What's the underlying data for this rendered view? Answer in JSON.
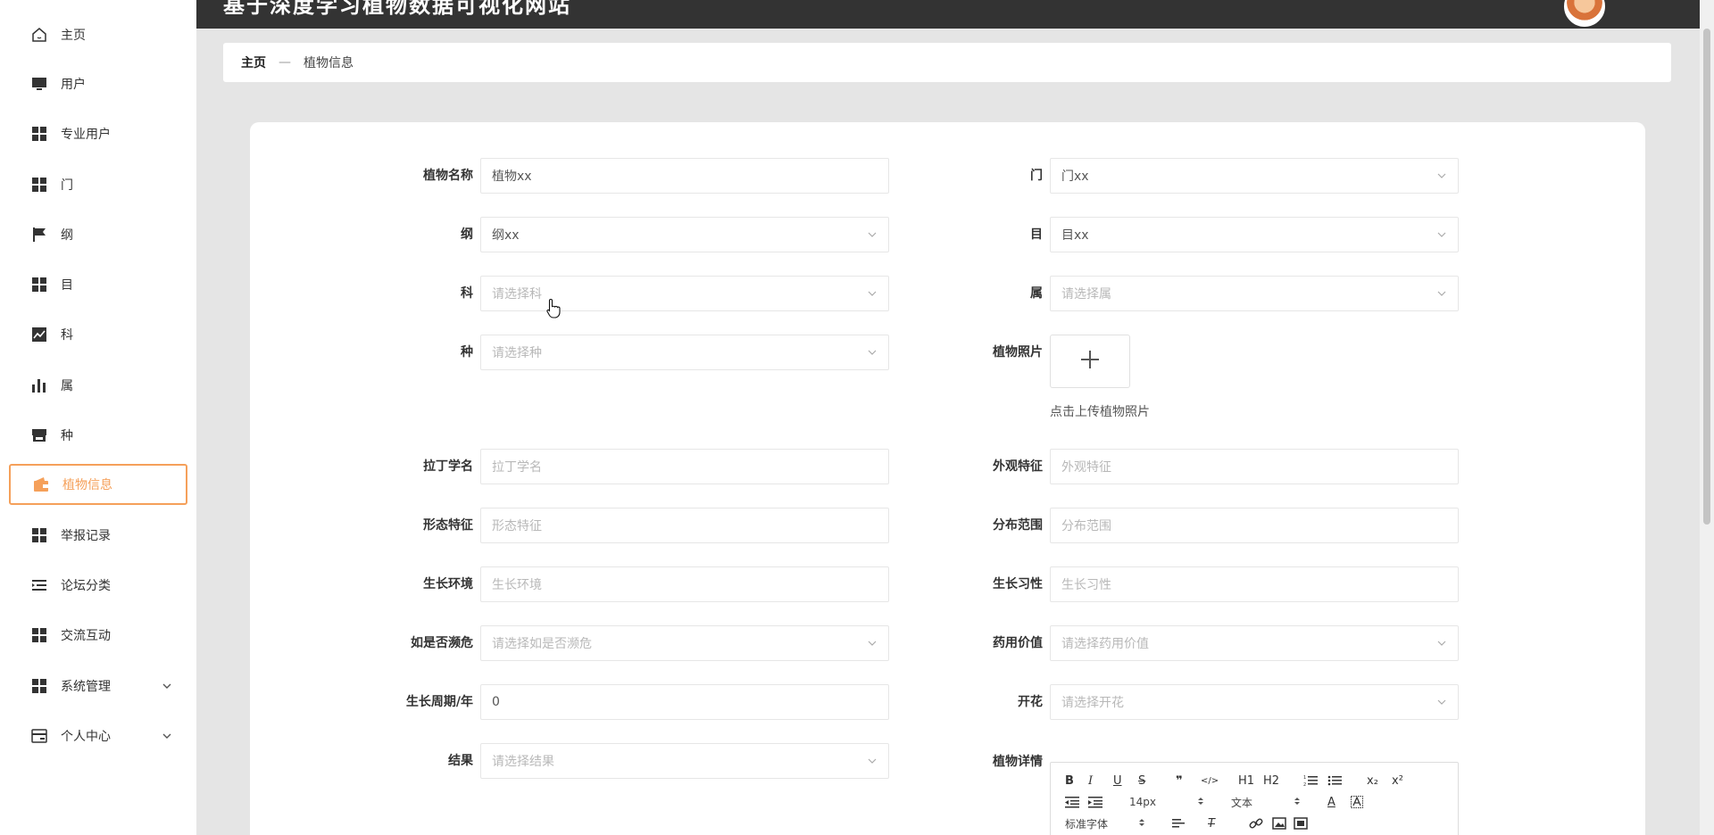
{
  "app": {
    "title": "基于深度学习植物数据可视化网站"
  },
  "sidebar": {
    "items": [
      {
        "label": "主页",
        "icon": "home-icon"
      },
      {
        "label": "用户",
        "icon": "monitor-icon"
      },
      {
        "label": "专业用户",
        "icon": "grid-icon"
      },
      {
        "label": "门",
        "icon": "grid-icon"
      },
      {
        "label": "纲",
        "icon": "flag-icon"
      },
      {
        "label": "目",
        "icon": "grid-icon"
      },
      {
        "label": "科",
        "icon": "line-chart-icon"
      },
      {
        "label": "属",
        "icon": "bar-chart-icon"
      },
      {
        "label": "种",
        "icon": "store-icon"
      },
      {
        "label": "植物信息",
        "icon": "wallet-icon",
        "active": true
      },
      {
        "label": "举报记录",
        "icon": "grid-icon"
      },
      {
        "label": "论坛分类",
        "icon": "list-indent-icon"
      },
      {
        "label": "交流互动",
        "icon": "grid-icon"
      },
      {
        "label": "系统管理",
        "icon": "grid-icon",
        "expandable": true
      },
      {
        "label": "个人中心",
        "icon": "id-card-icon",
        "expandable": true
      }
    ]
  },
  "breadcrumb": {
    "home": "主页",
    "separator": "—",
    "current": "植物信息"
  },
  "form": {
    "plant_name": {
      "label": "植物名称",
      "value": "植物xx"
    },
    "phylum": {
      "label": "门",
      "value": "门xx"
    },
    "class": {
      "label": "纲",
      "value": "纲xx"
    },
    "order": {
      "label": "目",
      "value": "目xx"
    },
    "family": {
      "label": "科",
      "placeholder": "请选择科"
    },
    "genus": {
      "label": "属",
      "placeholder": "请选择属"
    },
    "species": {
      "label": "种",
      "placeholder": "请选择种"
    },
    "photo": {
      "label": "植物照片",
      "hint": "点击上传植物照片"
    },
    "latin_name": {
      "label": "拉丁学名",
      "placeholder": "拉丁学名"
    },
    "appearance": {
      "label": "外观特征",
      "placeholder": "外观特征"
    },
    "morphology": {
      "label": "形态特征",
      "placeholder": "形态特征"
    },
    "distribution": {
      "label": "分布范围",
      "placeholder": "分布范围"
    },
    "environment": {
      "label": "生长环境",
      "placeholder": "生长环境"
    },
    "habit": {
      "label": "生长习性",
      "placeholder": "生长习性"
    },
    "endangered": {
      "label": "如是否濒危",
      "placeholder": "请选择如是否濒危"
    },
    "medicinal": {
      "label": "药用价值",
      "placeholder": "请选择药用价值"
    },
    "growth_cycle": {
      "label": "生长周期/年",
      "value": "0"
    },
    "flowering": {
      "label": "开花",
      "placeholder": "请选择开花"
    },
    "fruiting": {
      "label": "结果",
      "placeholder": "请选择结果"
    },
    "details": {
      "label": "植物详情"
    }
  },
  "editor": {
    "font_size": "14px",
    "block_type": "文本",
    "font_family": "标准字体",
    "bold": "B",
    "italic": "I",
    "underline": "U",
    "strike": "S",
    "blockquote": "❞",
    "code": "</>",
    "h1": "H1",
    "h2": "H2",
    "subscript": "x₂",
    "superscript": "x²",
    "color": "A",
    "clean": "T"
  },
  "colors": {
    "accent": "#f5a05a",
    "topbar": "#333333",
    "background": "#e5e5e5"
  }
}
